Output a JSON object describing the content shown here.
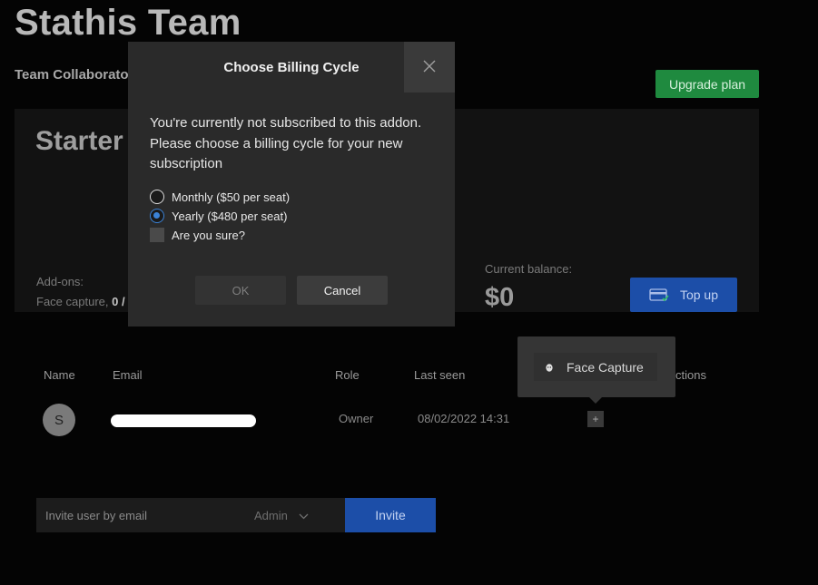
{
  "team": {
    "title": "Stathis Team",
    "subtitle": "Team Collaborato"
  },
  "header": {
    "upgrade_label": "Upgrade plan",
    "upgrade_color": "#1f8a3f"
  },
  "plan": {
    "name": "Starter",
    "addons_label": "Add-ons:",
    "addons_name": "Face capture,",
    "addons_count": "0 /",
    "balance_label": "Current balance:",
    "balance_value": "$0",
    "topup_label": "Top up",
    "topup_icon": "credit-card-icon"
  },
  "members_table": {
    "columns": [
      "Name",
      "Email",
      "Role",
      "Last seen",
      "ctions"
    ],
    "rows": [
      {
        "avatar_initial": "S",
        "email": "",
        "role": "Owner",
        "last_seen": "08/02/2022 14:31",
        "action_label": "+"
      }
    ]
  },
  "tooltip": {
    "item_label": "Face Capture",
    "item_icon": "face-icon"
  },
  "invite": {
    "placeholder": "Invite user by email",
    "role_value": "Admin",
    "button_label": "Invite",
    "button_color": "#1c4ea8"
  },
  "modal": {
    "title": "Choose Billing Cycle",
    "close_icon": "close-icon",
    "message": "You're currently not subscribed to this addon. Please choose a billing cycle for your new subscription",
    "options": [
      {
        "label": "Monthly ($50 per seat)",
        "selected": false
      },
      {
        "label": "Yearly ($480 per seat)",
        "selected": true
      }
    ],
    "confirm_label": "Are you sure?",
    "confirm_checked": false,
    "ok_label": "OK",
    "cancel_label": "Cancel"
  }
}
